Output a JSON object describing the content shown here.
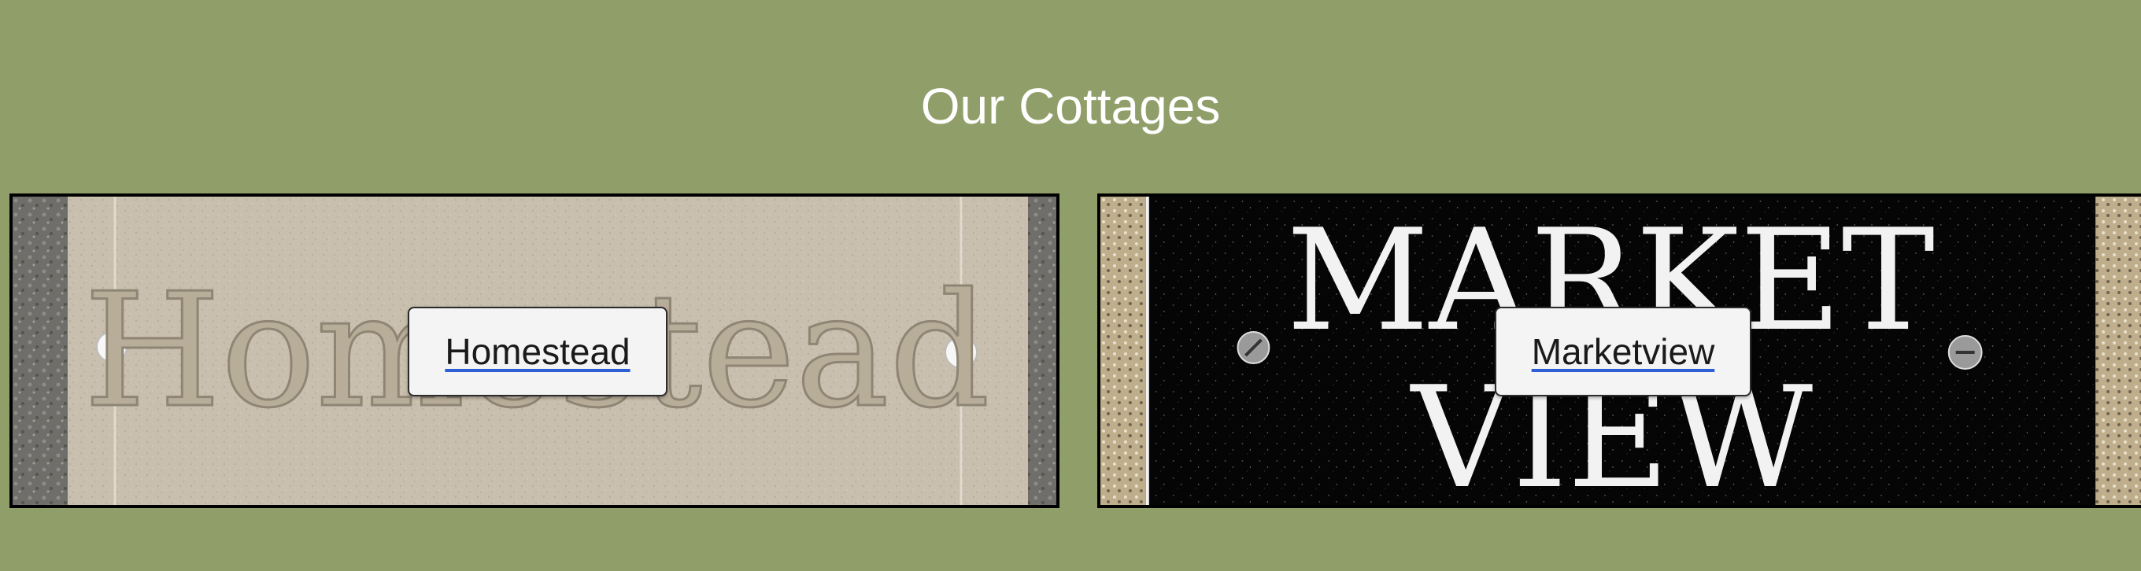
{
  "page": {
    "title": "Our Cottages"
  },
  "cottages": [
    {
      "name": "Homestead",
      "sign_text": "Homestead",
      "sign_style": "carved-stone"
    },
    {
      "name": "Marketview",
      "sign_text_line1": "MARKET",
      "sign_text_line2": "VIEW",
      "sign_style": "black-granite"
    }
  ],
  "colors": {
    "page_background": "#909f69",
    "title_text": "#ffffff",
    "card_border": "#000000",
    "caption_background": "#f4f4f4",
    "link_underline": "#2f5fd6"
  }
}
